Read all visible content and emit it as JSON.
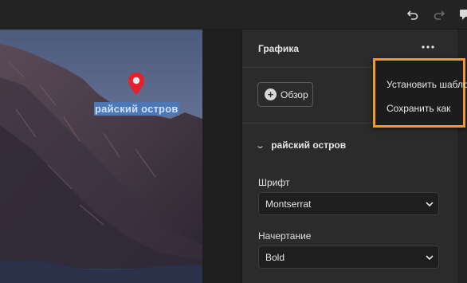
{
  "toolbar": {
    "undo_icon": "undo-icon",
    "redo_icon": "redo-icon",
    "comment_icon": "comment-icon"
  },
  "canvas": {
    "overlay_title": "райский остров",
    "pin_color": "#e8202b",
    "highlight_color": "#4d78b8"
  },
  "panel": {
    "title": "Графика",
    "browse_label": "Обзор",
    "section_name": "райский остров",
    "font_label": "Шрифт",
    "font_value": "Montserrat",
    "style_label": "Начертание",
    "style_value": "Bold"
  },
  "context_menu": {
    "items": [
      {
        "label": "Установить шаблон"
      },
      {
        "label": "Сохранить как"
      }
    ],
    "highlight_color": "#f19a24"
  }
}
